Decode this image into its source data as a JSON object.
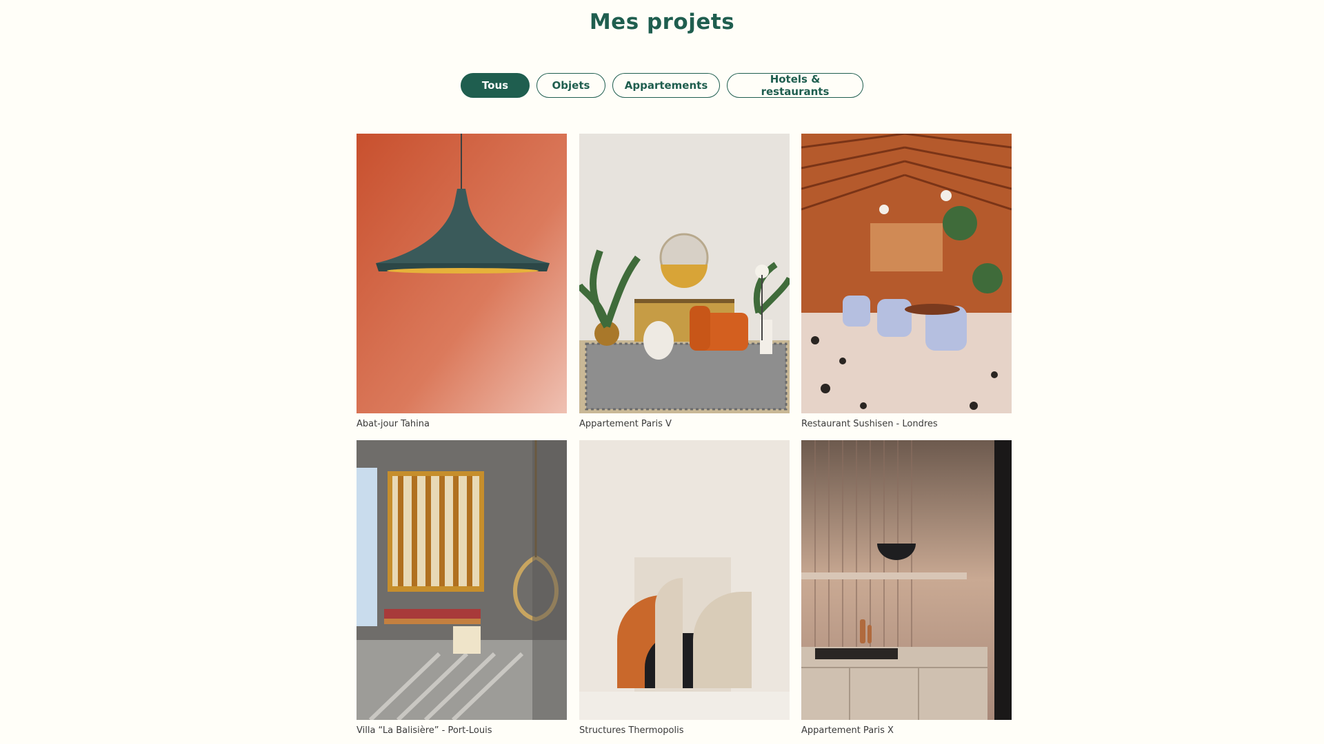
{
  "page": {
    "title": "Mes projets"
  },
  "filters": [
    {
      "label": "Tous",
      "active": true
    },
    {
      "label": "Objets",
      "active": false
    },
    {
      "label": "Appartements",
      "active": false
    },
    {
      "label": "Hotels & restaurants",
      "active": false
    }
  ],
  "projects": [
    {
      "caption": "Abat-jour Tahina",
      "image": "pendant-lamp-on-orange-wall"
    },
    {
      "caption": "Appartement Paris V",
      "image": "living-room-orange-armchair"
    },
    {
      "caption": "Restaurant Sushisen - Londres",
      "image": "restaurant-wooden-roof"
    },
    {
      "caption": "Villa “La Balisière” - Port-Louis",
      "image": "villa-wooden-screen-hanging-chair"
    },
    {
      "caption": "Structures Thermopolis",
      "image": "abstract-arch-shapes"
    },
    {
      "caption": "Appartement Paris X",
      "image": "kitchen-wooden-panels-lamp"
    }
  ],
  "colors": {
    "accent": "#1f5e4f",
    "background": "#fffef8"
  }
}
